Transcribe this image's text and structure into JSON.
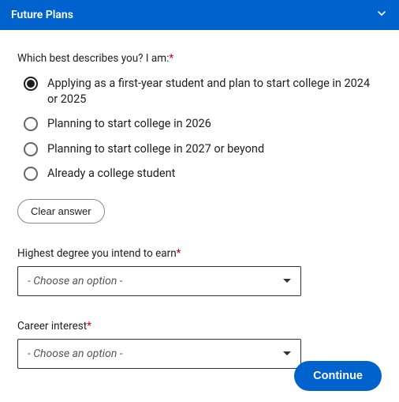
{
  "header": {
    "title": "Future Plans"
  },
  "question1": {
    "label": "Which best describes you? I am:",
    "options": [
      "Applying as a first-year student and plan to start college in 2024 or 2025",
      "Planning to start college in 2026",
      "Planning to start college in 2027 or beyond",
      "Already a college student"
    ],
    "selected_index": 0,
    "clear_label": "Clear answer"
  },
  "degree": {
    "label": "Highest degree you intend to earn",
    "placeholder": "- Choose an option -"
  },
  "career": {
    "label": "Career interest",
    "placeholder": "- Choose an option -"
  },
  "continue_label": "Continue",
  "required_marker": "*"
}
